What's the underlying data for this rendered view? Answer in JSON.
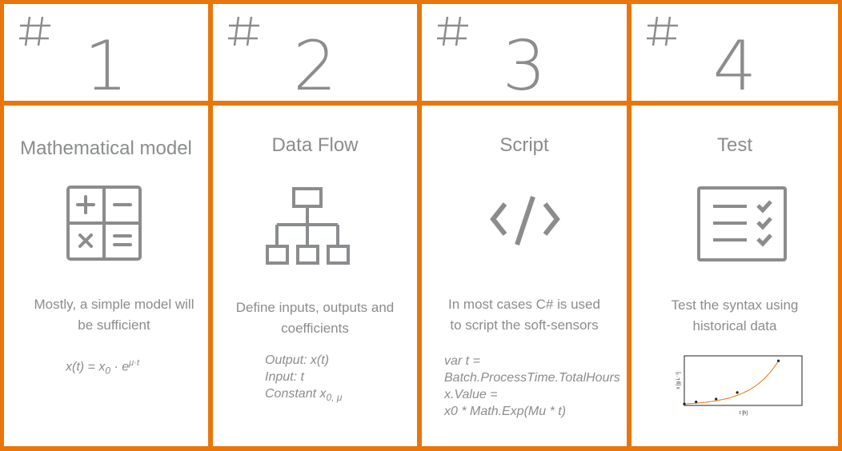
{
  "accent_color": "#e8760a",
  "text_color": "#8a8c8e",
  "steps": [
    {
      "number": "1",
      "hash": "#",
      "title": "Mathematical model",
      "icon": "calculator-icon",
      "description_line1": "Mostly, a simple model will",
      "description_line2": "be sufficient",
      "formula": {
        "lhs": "x(t) = x",
        "sub": "0",
        "mid": " ·  e",
        "sup": "μ·t"
      }
    },
    {
      "number": "2",
      "hash": "#",
      "title": "Data Flow",
      "icon": "hierarchy-icon",
      "description_line1": "Define inputs, outputs and",
      "description_line2": "coefficients",
      "details": {
        "output": "Output: x(t)",
        "input": "Input: t",
        "constant": "Constant x",
        "constant_sub": "0, μ"
      }
    },
    {
      "number": "3",
      "hash": "#",
      "title": "Script",
      "icon": "code-icon",
      "description_line1": "In most cases C# is used",
      "description_line2": "to script the soft-sensors",
      "code": [
        "var t =",
        "Batch.ProcessTime.TotalHours",
        "x.Value =",
        "x0 * Math.Exp(Mu * t)"
      ]
    },
    {
      "number": "4",
      "hash": "#",
      "title": "Test",
      "icon": "checklist-icon",
      "description_line1": "Test the syntax using",
      "description_line2": "historical data",
      "mini_chart": {
        "xlabel": "t [h]",
        "ylabel": "x [g L⁻¹]"
      }
    }
  ],
  "chart_data": {
    "type": "scatter",
    "title": "",
    "xlabel": "t [h]",
    "ylabel": "x [g L⁻¹]",
    "points": [
      [
        0,
        0.3
      ],
      [
        1,
        0.7
      ],
      [
        2.7,
        1.3
      ],
      [
        4.5,
        2.6
      ],
      [
        8,
        9
      ]
    ],
    "fit": "exponential",
    "xlim": [
      0,
      10
    ],
    "ylim": [
      0,
      10
    ],
    "fit_color": "#e8760a",
    "point_color": "#222222"
  }
}
